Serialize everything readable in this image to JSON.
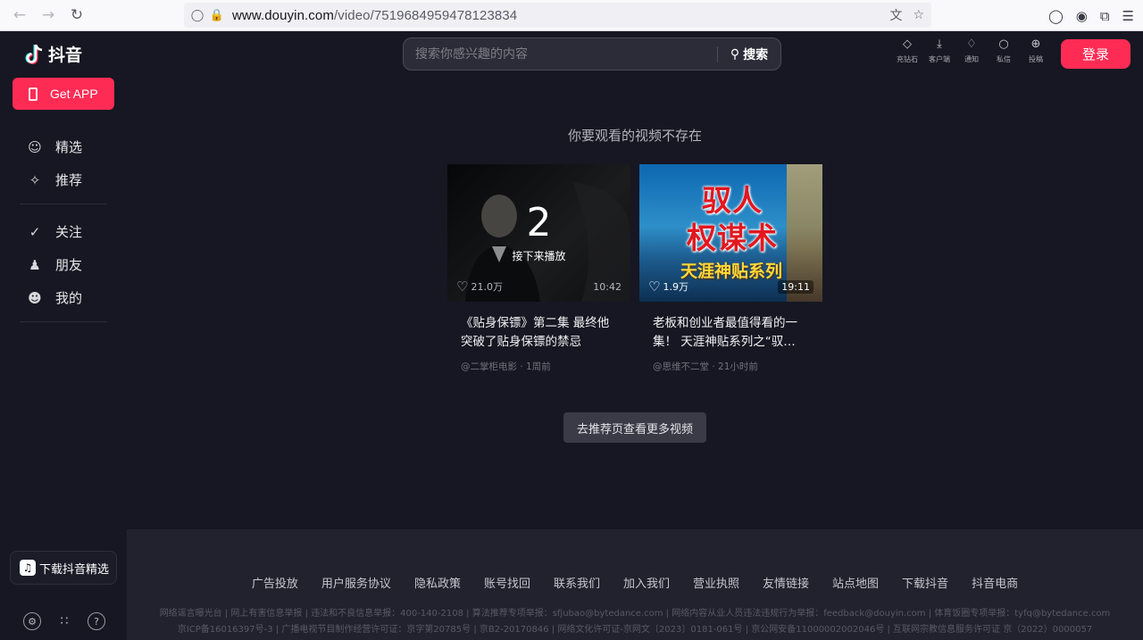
{
  "browser": {
    "url_host": "www.douyin.com",
    "url_path": "/video/7519684959478123834"
  },
  "sidebar": {
    "logo_text": "抖音",
    "get_app": "Get APP",
    "nav_top": [
      {
        "label": "精选",
        "icon": "home-smile-icon"
      },
      {
        "label": "推荐",
        "icon": "sparkle-icon"
      }
    ],
    "nav_mid": [
      {
        "label": "关注",
        "icon": "follow-icon"
      },
      {
        "label": "朋友",
        "icon": "friends-icon"
      },
      {
        "label": "我的",
        "icon": "profile-icon"
      }
    ],
    "download_label": "下载抖音精选"
  },
  "header": {
    "search_placeholder": "搜索你感兴趣的内容",
    "search_button": "搜索",
    "tools": [
      {
        "label": "充钻石",
        "icon": "diamond-icon"
      },
      {
        "label": "客户端",
        "icon": "download-icon"
      },
      {
        "label": "通知",
        "icon": "bell-icon"
      },
      {
        "label": "私信",
        "icon": "message-icon"
      },
      {
        "label": "投稿",
        "icon": "upload-icon"
      }
    ],
    "login": "登录"
  },
  "main": {
    "notice": "你要观看的视频不存在",
    "videos": [
      {
        "countdown": "2",
        "next_label": "接下来播放",
        "likes": "21.0万",
        "duration": "10:42",
        "title": "《贴身保镖》第二集 最终他突破了贴身保镖的禁忌",
        "author": "@二掌柜电影",
        "time": "1周前"
      },
      {
        "overlay_big_1": "驭人",
        "overlay_big_2": "权谋术",
        "overlay_sub": "天涯神贴系列",
        "likes": "1.9万",
        "duration": "19:11",
        "title": "老板和创业者最值得看的一集！ 天涯神贴系列之“驭…",
        "author": "@思维不二堂",
        "time": "21小时前"
      }
    ],
    "more_button": "去推荐页查看更多视频"
  },
  "footer": {
    "links": [
      "广告投放",
      "用户服务协议",
      "隐私政策",
      "账号找回",
      "联系我们",
      "加入我们",
      "营业执照",
      "友情链接",
      "站点地图",
      "下载抖音",
      "抖音电商"
    ],
    "legal_line_1": "网络谣言曝光台 | 网上有害信息举报 | 违法和不良信息举报：400-140-2108 | 算法推荐专项举报：sfjubao@bytedance.com | 网络内容从业人员违法违规行为举报：feedback@douyin.com | 体育饭圈专项举报：tyfq@bytedance.com",
    "legal_line_2": "京ICP备16016397号-3 | 广播电视节目制作经营许可证：京字第20785号 | 京B2-20170846 | 网络文化许可证-京网文〔2023〕0181-061号 | 京公网安备11000002002046号 | 互联网宗教信息服务许可证 京（2022）0000057"
  }
}
